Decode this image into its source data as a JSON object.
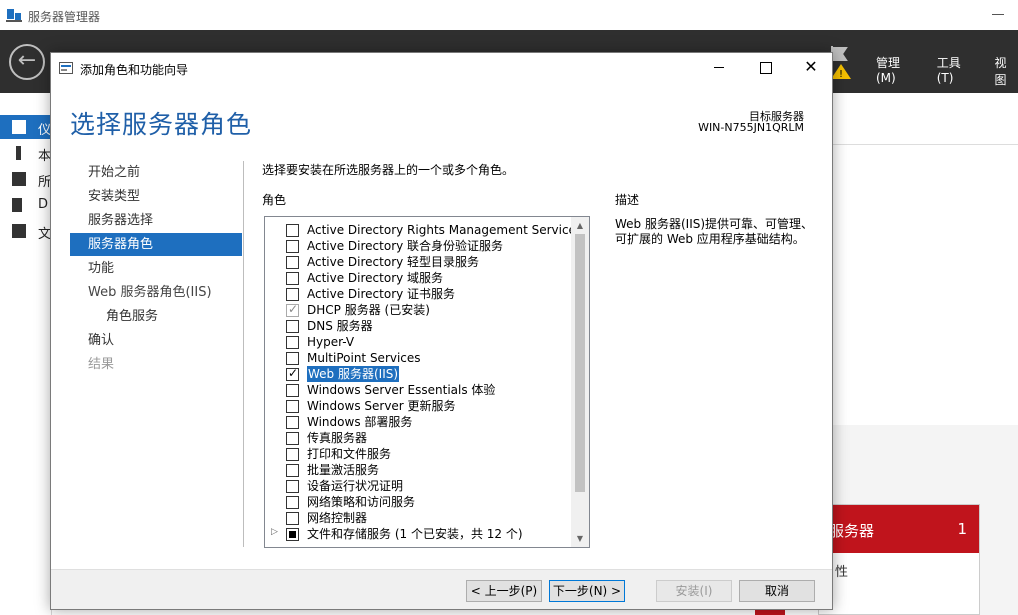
{
  "background_window": {
    "title": "服务器管理器",
    "menu": [
      "管理(M)",
      "工具(T)",
      "视图"
    ],
    "nav": [
      "仪",
      "本",
      "所",
      "D",
      "文"
    ],
    "tile": {
      "title": "服务器",
      "count": "1",
      "row": "性"
    }
  },
  "wizard": {
    "title": "添加角色和功能向导",
    "heading": "选择服务器角色",
    "target_label": "目标服务器",
    "target_name": "WIN-N755JN1QRLM",
    "steps": [
      {
        "label": "开始之前",
        "state": "normal"
      },
      {
        "label": "安装类型",
        "state": "normal"
      },
      {
        "label": "服务器选择",
        "state": "normal"
      },
      {
        "label": "服务器角色",
        "state": "active"
      },
      {
        "label": "功能",
        "state": "normal"
      },
      {
        "label": "Web 服务器角色(IIS)",
        "state": "normal"
      },
      {
        "label": "角色服务",
        "state": "sub"
      },
      {
        "label": "确认",
        "state": "normal"
      },
      {
        "label": "结果",
        "state": "disabled"
      }
    ],
    "instruction": "选择要安装在所选服务器上的一个或多个角色。",
    "roles_label": "角色",
    "description_label": "描述",
    "description_text": "Web 服务器(IIS)提供可靠、可管理、可扩展的 Web 应用程序基础结构。",
    "roles": [
      {
        "label": "Active Directory Rights Management Services",
        "checked": false
      },
      {
        "label": "Active Directory 联合身份验证服务",
        "checked": false
      },
      {
        "label": "Active Directory 轻型目录服务",
        "checked": false
      },
      {
        "label": "Active Directory 域服务",
        "checked": false
      },
      {
        "label": "Active Directory 证书服务",
        "checked": false
      },
      {
        "label": "DHCP 服务器 (已安装)",
        "checked": true,
        "disabled": true
      },
      {
        "label": "DNS 服务器",
        "checked": false
      },
      {
        "label": "Hyper-V",
        "checked": false
      },
      {
        "label": "MultiPoint Services",
        "checked": false
      },
      {
        "label": "Web 服务器(IIS)",
        "checked": true,
        "selected": true
      },
      {
        "label": "Windows Server Essentials 体验",
        "checked": false
      },
      {
        "label": "Windows Server 更新服务",
        "checked": false
      },
      {
        "label": "Windows 部署服务",
        "checked": false
      },
      {
        "label": "传真服务器",
        "checked": false
      },
      {
        "label": "打印和文件服务",
        "checked": false
      },
      {
        "label": "批量激活服务",
        "checked": false
      },
      {
        "label": "设备运行状况证明",
        "checked": false
      },
      {
        "label": "网络策略和访问服务",
        "checked": false
      },
      {
        "label": "网络控制器",
        "checked": false
      },
      {
        "label": "文件和存储服务 (1 个已安装，共 12 个)",
        "checked": false,
        "partial": true,
        "expandable": true
      }
    ],
    "buttons": {
      "prev": "< 上一步(P)",
      "next": "下一步(N) >",
      "install": "安装(I)",
      "cancel": "取消"
    }
  }
}
